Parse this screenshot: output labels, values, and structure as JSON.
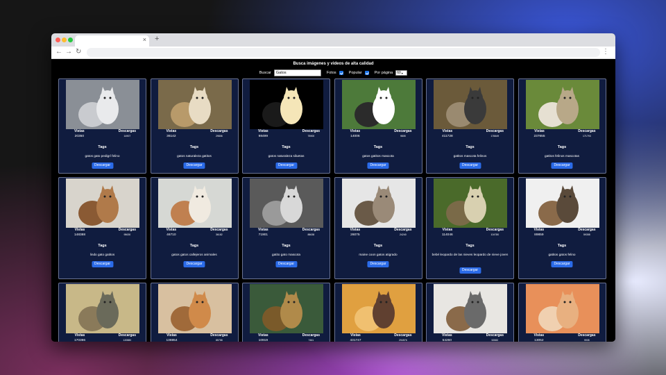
{
  "browser": {
    "tab_close": "×",
    "new_tab": "+",
    "back": "←",
    "forward": "→",
    "reload": "↻",
    "menu": "⋮"
  },
  "page": {
    "heading": "Busca imágenes y videos de alta calidad",
    "search_label": "Buscar",
    "search_value": "Gatos",
    "photos_label": "Fotos",
    "popular_label": "Popular",
    "per_page_label": "Por página",
    "per_page_value": "60"
  },
  "labels": {
    "views": "Vistas",
    "downloads": "Descargas",
    "tags": "Tags",
    "download_button": "Descargar"
  },
  "cards": [
    {
      "views": "20350",
      "downloads": "14907",
      "tags": "gatos  gato pedigrí  felino"
    },
    {
      "views": "36142",
      "downloads": "29806",
      "tags": "gatos  naturaleza  gatitos"
    },
    {
      "views": "98499",
      "downloads": "75900",
      "tags": "gatos  naturaleza  siluetas"
    },
    {
      "views": "14006",
      "downloads": "9805",
      "tags": "gatos  gatitos  mascota"
    },
    {
      "views": "411728",
      "downloads": "176649",
      "tags": "gatitos  mascota  felinos"
    },
    {
      "views": "237655",
      "downloads": "171793",
      "tags": "gatitos  felinos  mascotas"
    },
    {
      "views": "148388",
      "downloads": "95630",
      "tags": "lindo  gato  gatitos"
    },
    {
      "views": "46710",
      "downloads": "36182",
      "tags": "gatos  gatos callejeros  animales"
    },
    {
      "views": "71901",
      "downloads": "88638",
      "tags": "gatito  gato  mascota"
    },
    {
      "views": "26075",
      "downloads": "24240",
      "tags": "maine coon  gatos  atigrado"
    },
    {
      "views": "114046",
      "downloads": "104780",
      "tags": "bebé leopardo de las nieves  leopardo de nieve  joven"
    },
    {
      "views": "89859",
      "downloads": "59358",
      "tags": "gatitos  gatos  felino"
    },
    {
      "views": "170396",
      "downloads": "120880",
      "tags": ""
    },
    {
      "views": "136954",
      "downloads": "85758",
      "tags": ""
    },
    {
      "views": "10919",
      "downloads": "7461",
      "tags": ""
    },
    {
      "views": "431747",
      "downloads": "294576",
      "tags": ""
    },
    {
      "views": "54260",
      "downloads": "52882",
      "tags": ""
    },
    {
      "views": "13052",
      "downloads": "9935",
      "tags": ""
    }
  ],
  "colors": {
    "card_bg": "#101c3f",
    "button": "#2b6be8",
    "checkbox": "#1a73e8"
  }
}
